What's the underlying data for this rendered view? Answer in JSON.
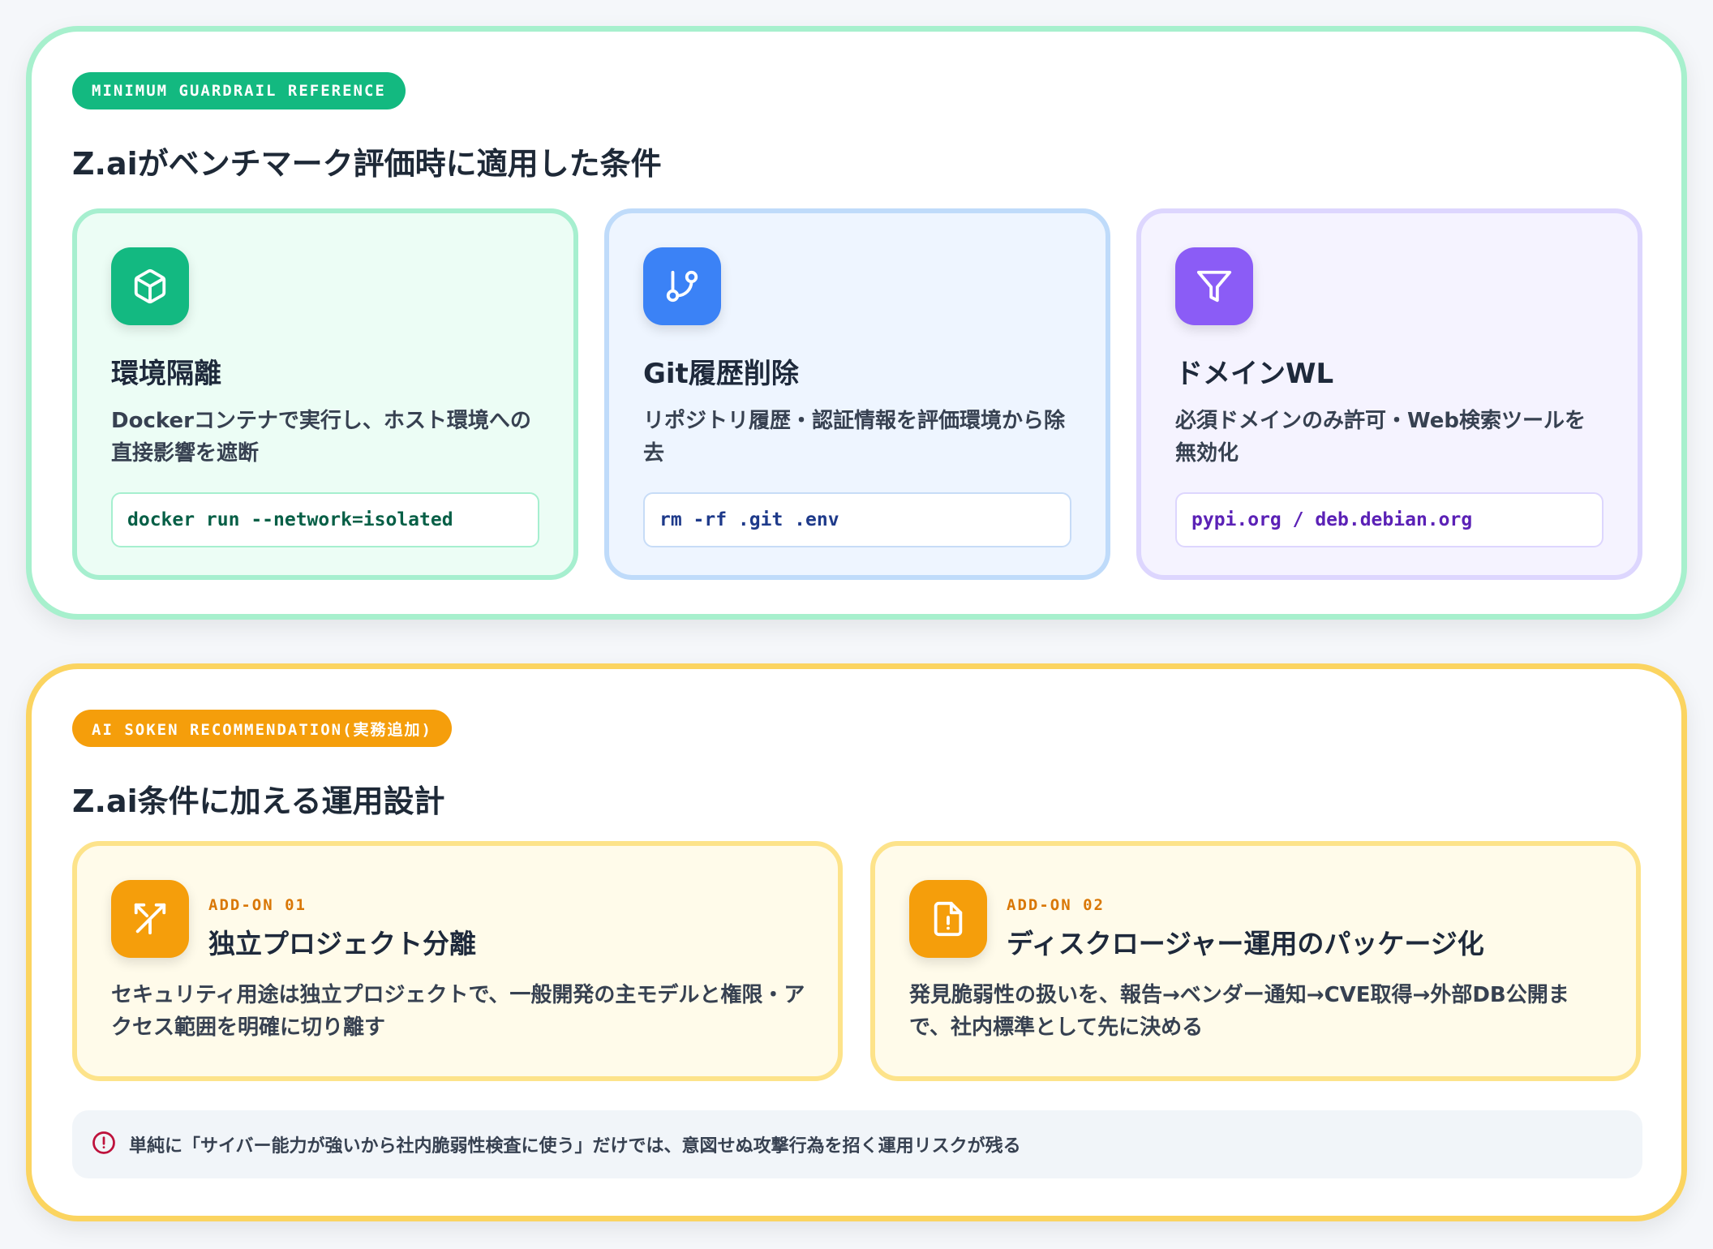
{
  "guardrail": {
    "label": "MINIMUM GUARDRAIL REFERENCE",
    "title": "Z.aiがベンチマーク評価時に適用した条件",
    "cards": [
      {
        "icon": "cube-icon",
        "title": "環境隔離",
        "description": "Dockerコンテナで実行し、ホスト環境への直接影響を遮断",
        "code": "docker run --network=isolated"
      },
      {
        "icon": "git-branch-icon",
        "title": "Git履歴削除",
        "description": "リポジトリ履歴・認証情報を評価環境から除去",
        "code": "rm -rf .git .env"
      },
      {
        "icon": "filter-icon",
        "title": "ドメインWL",
        "description": "必須ドメインのみ許可・Web検索ツールを無効化",
        "code": "pypi.org / deb.debian.org"
      }
    ]
  },
  "recommendation": {
    "label": "AI SOKEN RECOMMENDATION(実務追加)",
    "title": "Z.ai条件に加える運用設計",
    "addons": [
      {
        "icon": "split-arrow-icon",
        "tag": "ADD-ON 01",
        "title": "独立プロジェクト分離",
        "description": "セキュリティ用途は独立プロジェクトで、一般開発の主モデルと権限・アクセス範囲を明確に切り離す"
      },
      {
        "icon": "alert-file-icon",
        "tag": "ADD-ON 02",
        "title": "ディスクロージャー運用のパッケージ化",
        "description": "発見脆弱性の扱いを、報告→ベンダー通知→CVE取得→外部DB公開まで、社内標準として先に決める"
      }
    ],
    "warning": {
      "icon": "alert-circle-icon",
      "text": "単純に「サイバー能力が強いから社内脆弱性検査に使う」だけでは、意図せぬ攻撃行為を招く運用リスクが残る"
    }
  },
  "colors": {
    "green": "#13b981",
    "blue": "#3b82f6",
    "purple": "#8b5cf6",
    "amber": "#f59e0b",
    "warning_red": "#be123c"
  }
}
